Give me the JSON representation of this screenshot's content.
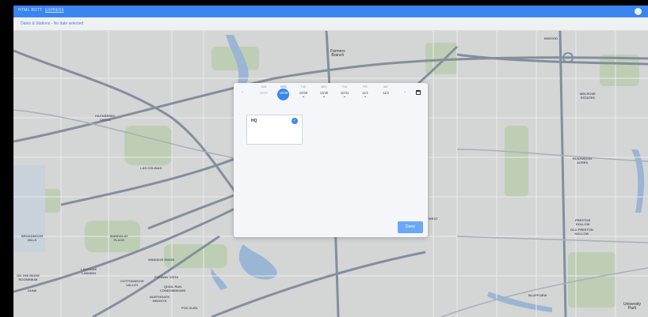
{
  "topbar": {
    "app_name": "HTML 8OTT",
    "link": "EXPRESS"
  },
  "subbar": {
    "title": "Dates & Stations - No date selected"
  },
  "map_labels": [
    "Farmers\nBranch",
    "INWOOD",
    "MELROSE\nESTATES",
    "HACKBERRY\nCREEK",
    "LAS COLINAS",
    "RUSHWOOD\nACRES",
    "BROADMOOR\nHILLS",
    "MANDALAY\nPLACE",
    "PRESTON\nHOLLOW",
    "OLD PRESTON\nHOLLOW",
    "WINDSOR RIDGE",
    "FAIRWAY VISTA",
    "LAKESIDE\nLANDING",
    "COTTONWOOD\nVALLEY",
    "QUAIL RUN\nCONDOMINIUMS",
    "NORTHGATE\nHEIGHTS",
    "FOX GLEN",
    "BLUFFVIEW",
    "University\nPark",
    "WEST",
    "DUNE",
    "ON THE RIDGE\nROOMINIUM"
  ],
  "date_picker": {
    "days": [
      {
        "dow": "SUN",
        "num": "10/27",
        "state": "past"
      },
      {
        "dow": "MON",
        "num": "10/28",
        "state": "selected"
      },
      {
        "dow": "TUE",
        "num": "10/29",
        "state": "dot"
      },
      {
        "dow": "WED",
        "num": "10/30",
        "state": "dot"
      },
      {
        "dow": "THU",
        "num": "10/31",
        "state": "dot"
      },
      {
        "dow": "FRI",
        "num": "11/1",
        "state": "dot"
      },
      {
        "dow": "SAT",
        "num": "11/2",
        "state": "normal"
      }
    ],
    "prev_icon": "‹",
    "next_icon": "›"
  },
  "station": {
    "name": "HQ",
    "checked": true
  },
  "done_label": "Done",
  "colors": {
    "accent": "#3b86f0",
    "topbar": "#3a86f0",
    "done": "#6aa8f5"
  }
}
